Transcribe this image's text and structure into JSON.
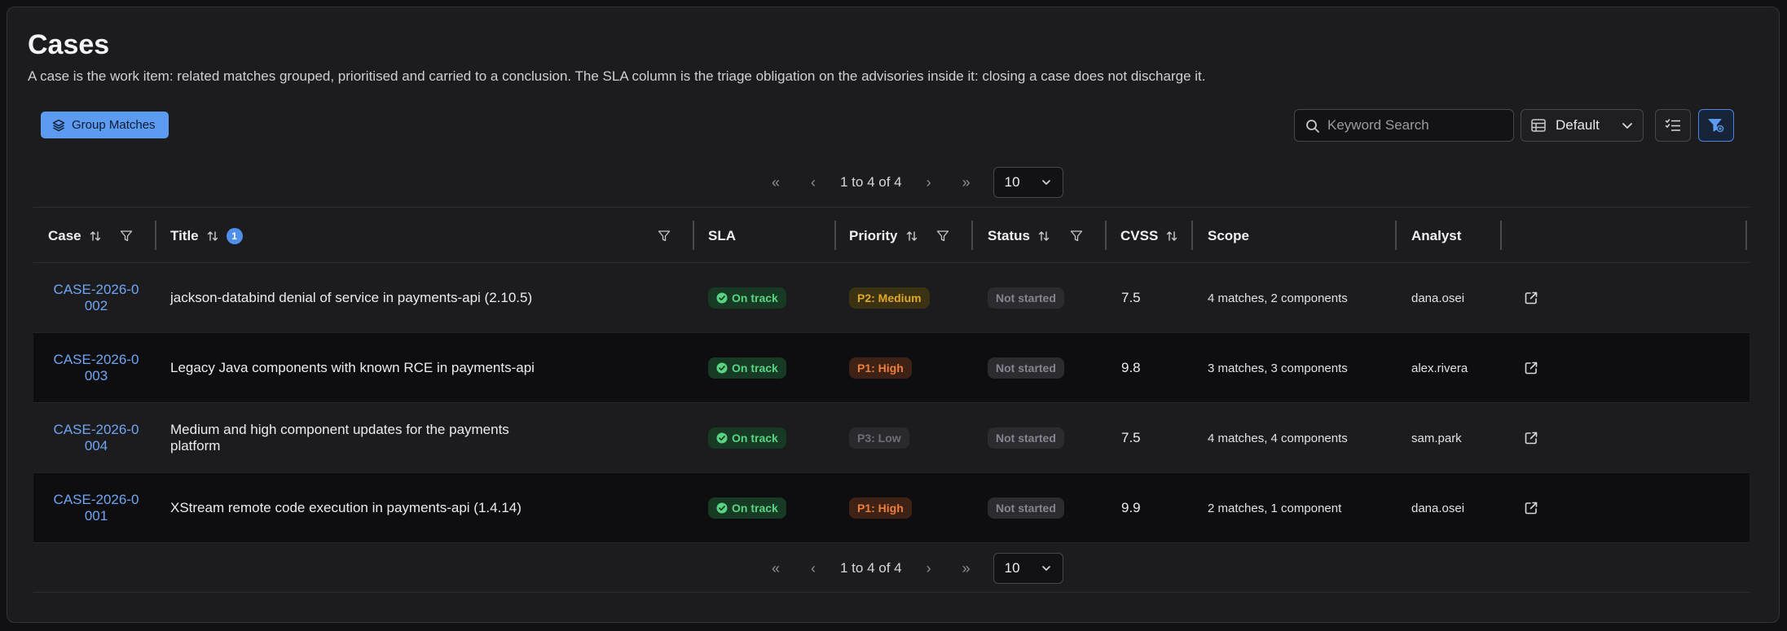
{
  "page": {
    "title": "Cases",
    "description": "A case is the work item: related matches grouped, prioritised and carried to a conclusion. The SLA column is the triage obligation on the advisories inside it: closing a case does not discharge it."
  },
  "toolbar": {
    "group_button": "Group Matches",
    "search_placeholder": "Keyword Search",
    "view_select": "Default"
  },
  "pagination": {
    "range_text": "1 to 4 of 4",
    "page_size": "10"
  },
  "table": {
    "columns": {
      "case": "Case",
      "title": "Title",
      "title_sort_badge": "1",
      "sla": "SLA",
      "priority": "Priority",
      "status": "Status",
      "cvss": "CVSS",
      "scope": "Scope",
      "analyst": "Analyst"
    },
    "rows": [
      {
        "case_line1": "CASE-2026-0",
        "case_line2": "002",
        "title": "jackson-databind denial of service in payments-api (2.10.5)",
        "sla": "On track",
        "priority": "P2: Medium",
        "priority_level": "p2",
        "status": "Not started",
        "cvss": "7.5",
        "scope": "4 matches, 2 components",
        "analyst": "dana.osei"
      },
      {
        "case_line1": "CASE-2026-0",
        "case_line2": "003",
        "title": "Legacy Java components with known RCE in payments-api",
        "sla": "On track",
        "priority": "P1: High",
        "priority_level": "p1",
        "status": "Not started",
        "cvss": "9.8",
        "scope": "3 matches, 3 components",
        "analyst": "alex.rivera"
      },
      {
        "case_line1": "CASE-2026-0",
        "case_line2": "004",
        "title": "Medium and high component updates for the payments platform",
        "sla": "On track",
        "priority": "P3: Low",
        "priority_level": "p3",
        "status": "Not started",
        "cvss": "7.5",
        "scope": "4 matches, 4 components",
        "analyst": "sam.park"
      },
      {
        "case_line1": "CASE-2026-0",
        "case_line2": "001",
        "title": "XStream remote code execution in payments-api (1.4.14)",
        "sla": "On track",
        "priority": "P1: High",
        "priority_level": "p1",
        "status": "Not started",
        "cvss": "9.9",
        "scope": "2 matches, 1 component",
        "analyst": "dana.osei"
      }
    ]
  },
  "colors": {
    "accent": "#5b9cf0",
    "link": "#6fa6f2",
    "sla_on_track": "#58d483",
    "priority_medium": "#e0a82a",
    "priority_high": "#ef7d3c",
    "priority_low": "#6e6e74"
  }
}
